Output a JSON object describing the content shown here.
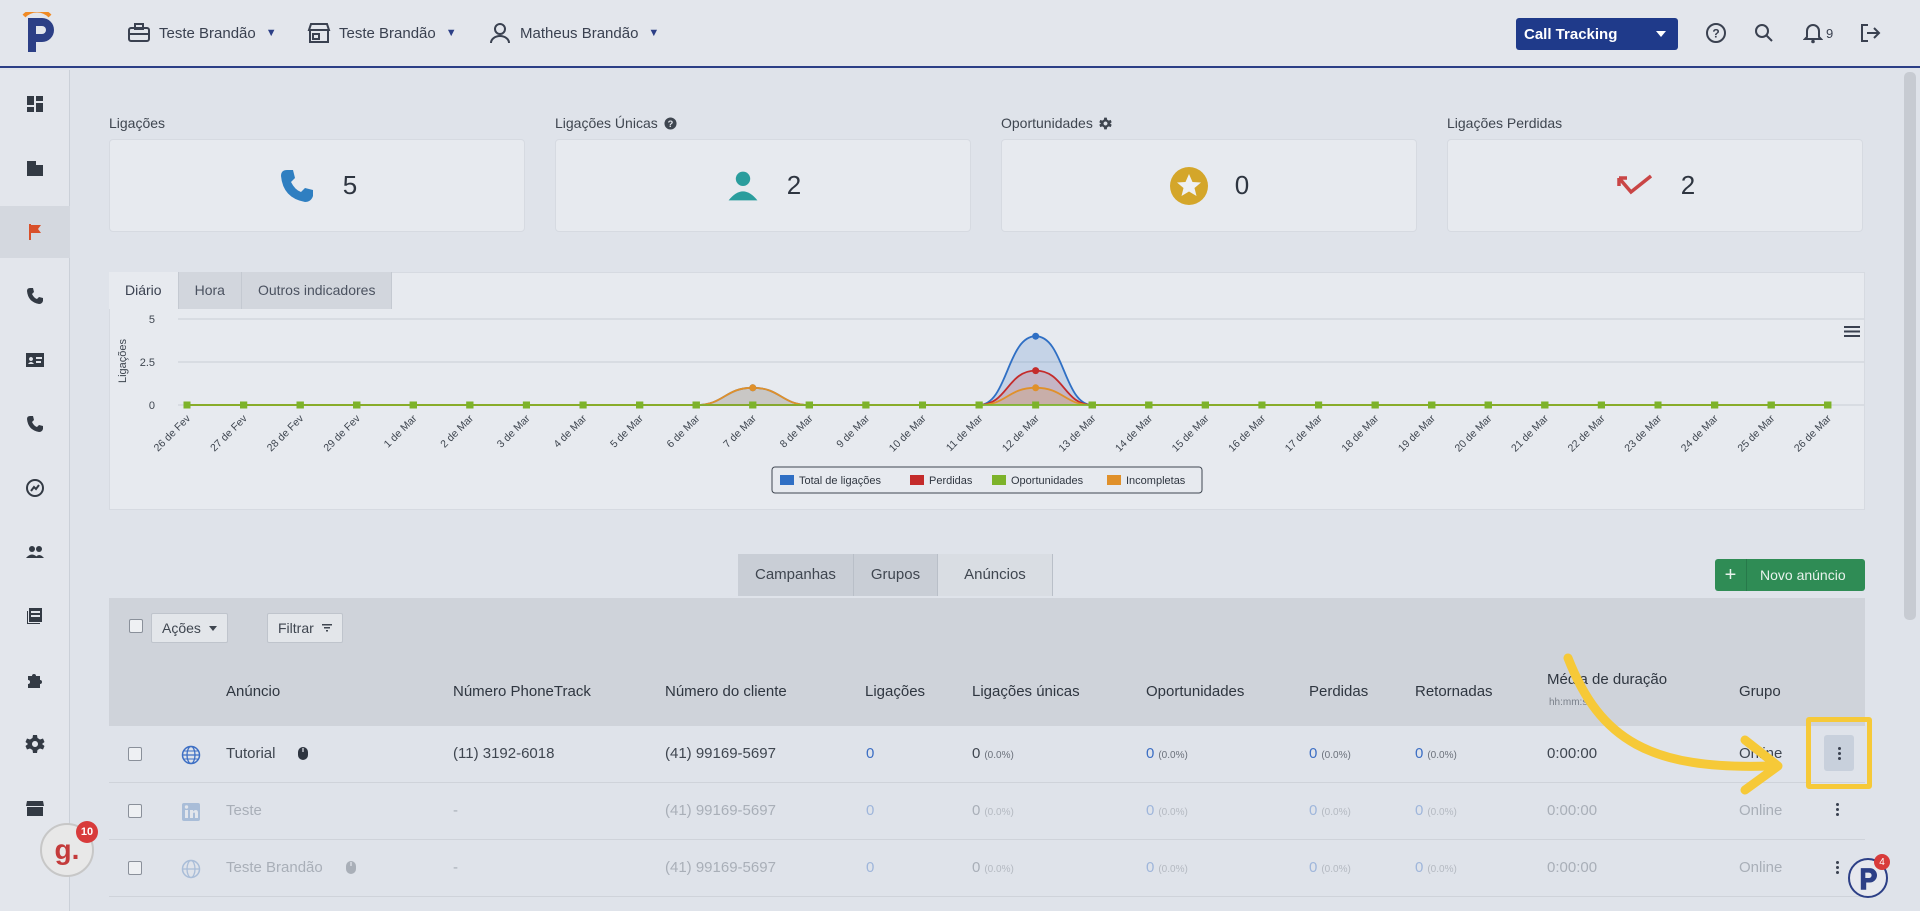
{
  "topbar": {
    "company": "Teste Brandão",
    "store": "Teste Brandão",
    "user": "Matheus Brandão",
    "product_select": "Call Tracking",
    "notifications_count": "9"
  },
  "sidebar": {
    "items": [
      "dashboard-icon",
      "building-icon",
      "flag-icon",
      "phone-icon",
      "contact-card-icon",
      "phone-icon",
      "chart-icon",
      "users-icon",
      "book-icon",
      "puzzle-icon",
      "gear-icon",
      "store-icon"
    ]
  },
  "kpis": [
    {
      "label": "Ligações",
      "value": "5",
      "icon": "phone-icon",
      "color": "#2f7fc1"
    },
    {
      "label": "Ligações Únicas",
      "value": "2",
      "icon": "user-icon",
      "color": "#2a9d9d"
    },
    {
      "label": "Oportunidades",
      "value": "0",
      "icon": "star-icon",
      "color": "#d4a62a"
    },
    {
      "label": "Ligações Perdidas",
      "value": "2",
      "icon": "missed-call-icon",
      "color": "#c94545"
    }
  ],
  "chart_tabs": [
    "Diário",
    "Hora",
    "Outros indicadores"
  ],
  "chart_data": {
    "type": "area",
    "ylabel": "Ligações",
    "ylim": [
      0,
      5
    ],
    "y_ticks": [
      "5",
      "2.5",
      "0"
    ],
    "categories": [
      "26 de Fev",
      "27 de Fev",
      "28 de Fev",
      "29 de Fev",
      "1 de Mar",
      "2 de Mar",
      "3 de Mar",
      "4 de Mar",
      "5 de Mar",
      "6 de Mar",
      "7 de Mar",
      "8 de Mar",
      "9 de Mar",
      "10 de Mar",
      "11 de Mar",
      "12 de Mar",
      "13 de Mar",
      "14 de Mar",
      "15 de Mar",
      "16 de Mar",
      "17 de Mar",
      "18 de Mar",
      "19 de Mar",
      "20 de Mar",
      "21 de Mar",
      "22 de Mar",
      "23 de Mar",
      "24 de Mar",
      "25 de Mar",
      "26 de Mar"
    ],
    "series": [
      {
        "name": "Total de ligações",
        "color": "#2f6fc4",
        "values": [
          0,
          0,
          0,
          0,
          0,
          0,
          0,
          0,
          0,
          0,
          1,
          0,
          0,
          0,
          0,
          4,
          0,
          0,
          0,
          0,
          0,
          0,
          0,
          0,
          0,
          0,
          0,
          0,
          0,
          0
        ]
      },
      {
        "name": "Perdidas",
        "color": "#c42b2b",
        "values": [
          0,
          0,
          0,
          0,
          0,
          0,
          0,
          0,
          0,
          0,
          0,
          0,
          0,
          0,
          0,
          2,
          0,
          0,
          0,
          0,
          0,
          0,
          0,
          0,
          0,
          0,
          0,
          0,
          0,
          0
        ]
      },
      {
        "name": "Oportunidades",
        "color": "#7db32a",
        "values": [
          0,
          0,
          0,
          0,
          0,
          0,
          0,
          0,
          0,
          0,
          0,
          0,
          0,
          0,
          0,
          0,
          0,
          0,
          0,
          0,
          0,
          0,
          0,
          0,
          0,
          0,
          0,
          0,
          0,
          0
        ]
      },
      {
        "name": "Incompletas",
        "color": "#e0902a",
        "values": [
          0,
          0,
          0,
          0,
          0,
          0,
          0,
          0,
          0,
          0,
          1,
          0,
          0,
          0,
          0,
          1,
          0,
          0,
          0,
          0,
          0,
          0,
          0,
          0,
          0,
          0,
          0,
          0,
          0,
          0
        ]
      }
    ],
    "grid": true,
    "legend": "bottom-center"
  },
  "list_tabs": [
    "Campanhas",
    "Grupos",
    "Anúncios"
  ],
  "new_button": "Novo anúncio",
  "toolbar": {
    "actions": "Ações",
    "filter": "Filtrar"
  },
  "table": {
    "headers": {
      "ad": "Anúncio",
      "phonetrack": "Número PhoneTrack",
      "client": "Número do cliente",
      "calls": "Ligações",
      "unique": "Ligações únicas",
      "opps": "Oportunidades",
      "lost": "Perdidas",
      "returned": "Retornadas",
      "avg": "Média de duração",
      "avg_sub": "hh:mm:ss",
      "group": "Grupo"
    },
    "rows": [
      {
        "icon": "globe-icon",
        "name": "Tutorial",
        "phonetrack": "(11) 3192-6018",
        "client": "(41) 99169-5697",
        "calls": "0",
        "unique": "0",
        "unique_pct": "(0.0%)",
        "opps": "0",
        "opps_pct": "(0.0%)",
        "lost": "0",
        "lost_pct": "(0.0%)",
        "returned": "0",
        "returned_pct": "(0.0%)",
        "avg": "0:00:00",
        "group": "Online"
      },
      {
        "icon": "linkedin-icon",
        "name": "Teste",
        "phonetrack": "-",
        "client": "(41) 99169-5697",
        "calls": "0",
        "unique": "0",
        "unique_pct": "(0.0%)",
        "opps": "0",
        "opps_pct": "(0.0%)",
        "lost": "0",
        "lost_pct": "(0.0%)",
        "returned": "0",
        "returned_pct": "(0.0%)",
        "avg": "0:00:00",
        "group": "Online"
      },
      {
        "icon": "globe-icon",
        "name": "Teste Brandão",
        "phonetrack": "-",
        "client": "(41) 99169-5697",
        "calls": "0",
        "unique": "0",
        "unique_pct": "(0.0%)",
        "opps": "0",
        "opps_pct": "(0.0%)",
        "lost": "0",
        "lost_pct": "(0.0%)",
        "returned": "0",
        "returned_pct": "(0.0%)",
        "avg": "0:00:00",
        "group": "Online"
      }
    ]
  },
  "widgets": {
    "g_badge": "g.",
    "g_count": "10",
    "p_count": "4"
  }
}
